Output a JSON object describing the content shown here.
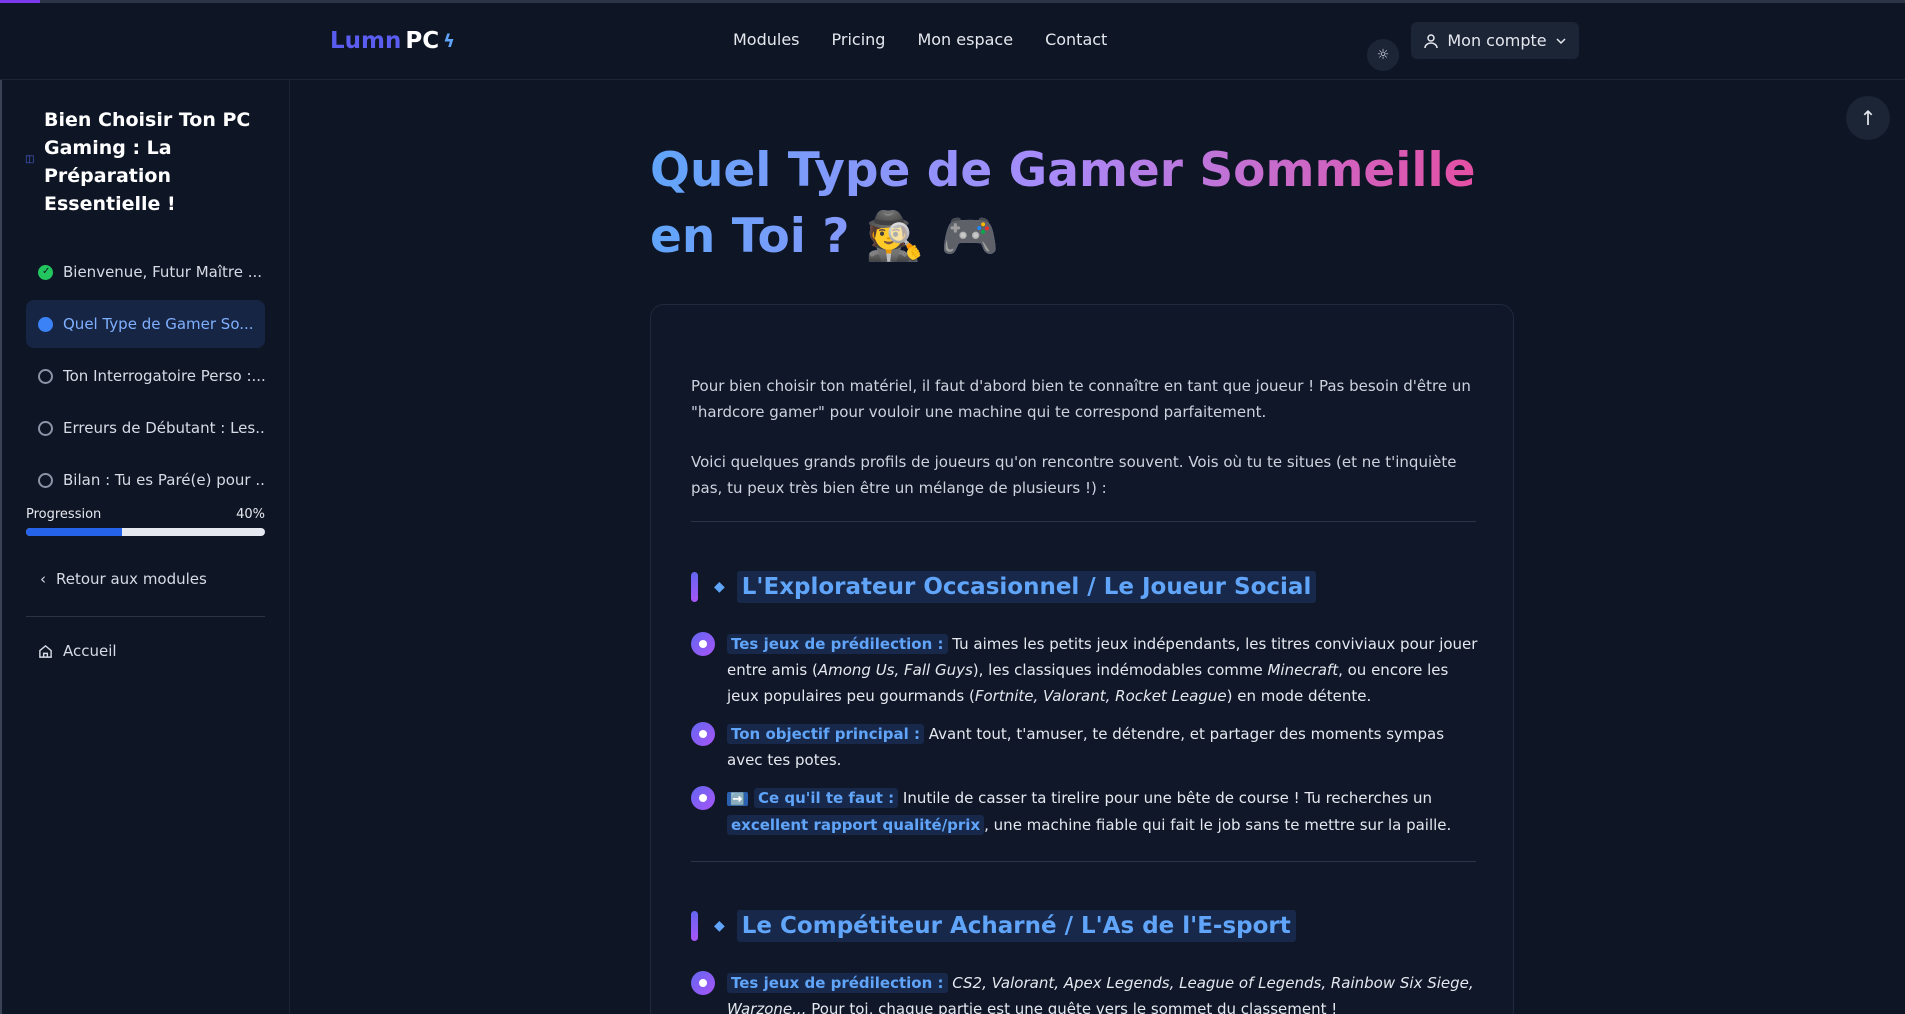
{
  "header": {
    "brand_lumn": "Lumn",
    "brand_pc": "PC",
    "brand_icon": "bolt-icon",
    "nav": [
      "Modules",
      "Pricing",
      "Mon espace",
      "Contact"
    ],
    "account_label": "Mon compte"
  },
  "sidebar": {
    "course_title": "Bien Choisir Ton PC Gaming : La Préparation Essentielle !",
    "lessons": [
      {
        "label": "Bienvenue, Futur Maître ...",
        "status": "done"
      },
      {
        "label": "Quel Type de Gamer So...",
        "status": "current"
      },
      {
        "label": "Ton Interrogatoire Perso :...",
        "status": "todo"
      },
      {
        "label": "Erreurs de Débutant : Les...",
        "status": "todo"
      },
      {
        "label": "Bilan : Tu es Paré(e) pour ...",
        "status": "todo"
      }
    ],
    "progress_label": "Progression",
    "progress_text": "40%",
    "progress_value": 0.4,
    "back_label": "Retour aux modules",
    "home_label": "Accueil"
  },
  "main": {
    "title": "Quel Type de Gamer Sommeille en Toi ?",
    "title_emojis": "🕵️ 🎮",
    "intro_1": "Pour bien choisir ton matériel, il faut d'abord bien te connaître en tant que joueur ! Pas besoin d'être un \"hardcore gamer\" pour vouloir une machine qui te correspond parfaitement.",
    "intro_2": "Voici quelques grands profils de joueurs qu'on rencontre souvent. Vois où tu te situes (et ne t'inquiète pas, tu peux très bien être un mélange de plusieurs !) :",
    "section1": {
      "title": "L'Explorateur Occasionnel / Le Joueur Social",
      "b1_tag": "Tes jeux de prédilection :",
      "b1_text_a": " Tu aimes les petits jeux indépendants, les titres conviviaux pour jouer entre amis (",
      "b1_games_a": "Among Us, Fall Guys",
      "b1_text_b": "), les classiques indémodables comme ",
      "b1_games_b": "Minecraft",
      "b1_text_c": ", ou encore les jeux populaires peu gourmands (",
      "b1_games_c": "Fortnite, Valorant, Rocket League",
      "b1_text_d": ") en mode détente.",
      "b2_tag": "Ton objectif principal :",
      "b2_text": " Avant tout, t'amuser, te détendre, et partager des moments sympas avec tes potes.",
      "b3_emoji": "➡️",
      "b3_tag": "Ce qu'il te faut :",
      "b3_text_a": " Inutile de casser ta tirelire pour une bête de course ! Tu recherches un ",
      "b3_highlight": "excellent rapport qualité/prix",
      "b3_text_b": ", une machine fiable qui fait le job sans te mettre sur la paille."
    },
    "section2": {
      "title": "Le Compétiteur Acharné / L'As de l'E-sport",
      "b1_tag": "Tes jeux de prédilection :",
      "b1_games": "CS2, Valorant, Apex Legends, League of Legends, Rainbow Six Siege, Warzone...",
      "b1_text": " Pour toi, chaque partie est une quête vers le sommet du classement !"
    }
  }
}
